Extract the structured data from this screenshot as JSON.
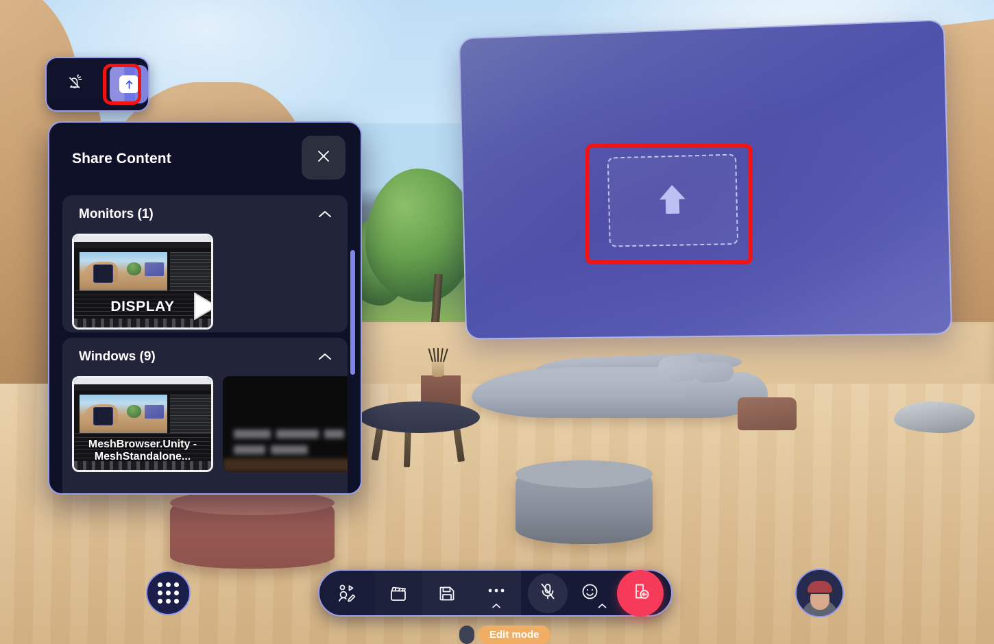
{
  "app": {
    "name": "Microsoft Mesh Immersive Space",
    "accent_purple": "#8f95ee",
    "panel_bg": "#0e1128",
    "annotation_color": "#f01414",
    "leave_color": "#f63b5a",
    "edit_badge_color": "#efae63"
  },
  "top_toolbar": {
    "notifications_icon": "bell-slash-icon",
    "share_icon": "share-screen-upload-icon",
    "share_active": true
  },
  "share_panel": {
    "title": "Share Content",
    "close_icon": "close-icon",
    "sections": [
      {
        "id": "monitors",
        "title": "Monitors (1)",
        "chevron_icon": "chevron-up-icon",
        "expanded": true,
        "items": [
          {
            "label": "DISPLAY",
            "type": "monitor",
            "selected": true,
            "cursor_icon": "play-cursor-icon"
          }
        ]
      },
      {
        "id": "windows",
        "title": "Windows (9)",
        "chevron_icon": "chevron-up-icon",
        "expanded": true,
        "items": [
          {
            "label": "MeshBrowser.Unity - MeshStandalone...",
            "type": "window",
            "selected": false
          },
          {
            "label": "",
            "type": "window",
            "blurred": true
          }
        ]
      }
    ],
    "scrollbar_visible": true
  },
  "big_screen": {
    "state": "empty-dropzone",
    "dropzone_icon": "arrow-up-icon",
    "highlighted": true
  },
  "bottom_bar": {
    "apps_button": {
      "icon": "grid-apps-icon",
      "label": ""
    },
    "items": [
      {
        "name": "customize-avatar",
        "icon": "avatar-edit-icon",
        "has_chevron": false
      },
      {
        "name": "record-clip",
        "icon": "clapperboard-icon",
        "has_chevron": false
      },
      {
        "name": "save-scene",
        "icon": "floppy-save-icon",
        "has_chevron": false
      },
      {
        "name": "more-options",
        "icon": "more-dots-icon",
        "has_chevron": true
      },
      {
        "name": "microphone",
        "icon": "mic-muted-icon",
        "has_chevron": false,
        "muted": true
      },
      {
        "name": "reactions",
        "icon": "emoji-smiley-icon",
        "has_chevron": true
      },
      {
        "name": "leave",
        "icon": "leave-door-icon",
        "has_chevron": false
      }
    ]
  },
  "status": {
    "edit_mode_label": "Edit mode",
    "edit_mode_active": true
  },
  "self_view": {
    "avatar_name": "self-avatar",
    "cap_color": "#a6414a",
    "shirt_color": "#5e6470"
  }
}
